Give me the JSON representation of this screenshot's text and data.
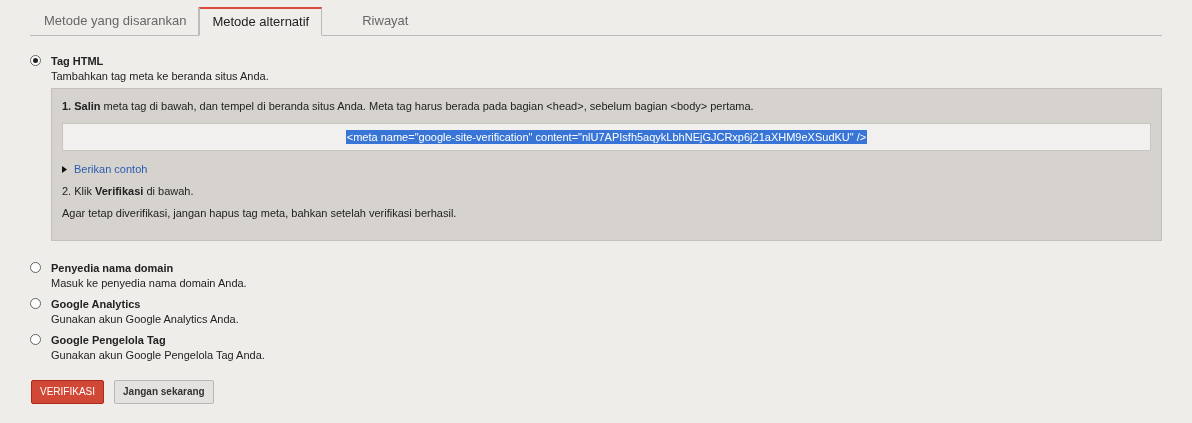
{
  "tabs": [
    {
      "label": "Metode yang disarankan",
      "selected": false
    },
    {
      "label": "Metode alternatif",
      "selected": true
    },
    {
      "label": "Riwayat",
      "selected": false
    }
  ],
  "options": [
    {
      "title": "Tag HTML",
      "description": "Tambahkan tag meta ke beranda situs Anda.",
      "selected": true,
      "details": {
        "step1": "**1. Salin** meta tag di bawah, dan tempel di beranda situs Anda. Meta tag harus berada pada bagian <head>, sebelum bagian <body> pertama.",
        "meta_tag": "<meta name=\"google-site-verification\" content=\"nlU7APIsfh5aqykLbhNEjGJCRxp6j21aXHM9eXSudKU\" />",
        "example_link": "Berikan contoh",
        "example_expanded": false,
        "step2": "2. Klik **Verifikasi** di bawah.",
        "note": "Agar tetap diverifikasi, jangan hapus tag meta, bahkan setelah verifikasi berhasil."
      }
    },
    {
      "title": "Penyedia nama domain",
      "description": "Masuk ke penyedia nama domain Anda.",
      "selected": false
    },
    {
      "title": "Google Analytics",
      "description": "Gunakan akun Google Analytics Anda.",
      "selected": false
    },
    {
      "title": "Google Pengelola Tag",
      "description": "Gunakan akun Google Pengelola Tag Anda.",
      "selected": false
    }
  ],
  "buttons": [
    {
      "label": "VERIFIKASI",
      "kind": "primary"
    },
    {
      "label": "Jangan sekarang",
      "kind": "secondary"
    }
  ]
}
